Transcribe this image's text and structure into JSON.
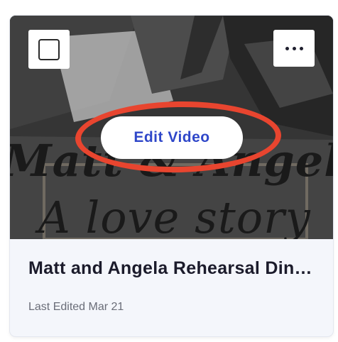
{
  "card": {
    "thumbnail": {
      "overlay_line1": "Matt & Angela",
      "overlay_line2": "A love story"
    },
    "select_checkbox": {
      "checked": false
    },
    "more_menu_icon": "more-horizontal-icon",
    "edit_button_label": "Edit Video",
    "title": "Matt and Angela Rehearsal Dinner",
    "meta": "Last Edited Mar 21",
    "colors": {
      "accent": "#2f47c9",
      "highlight_ring": "#e8452f"
    }
  }
}
